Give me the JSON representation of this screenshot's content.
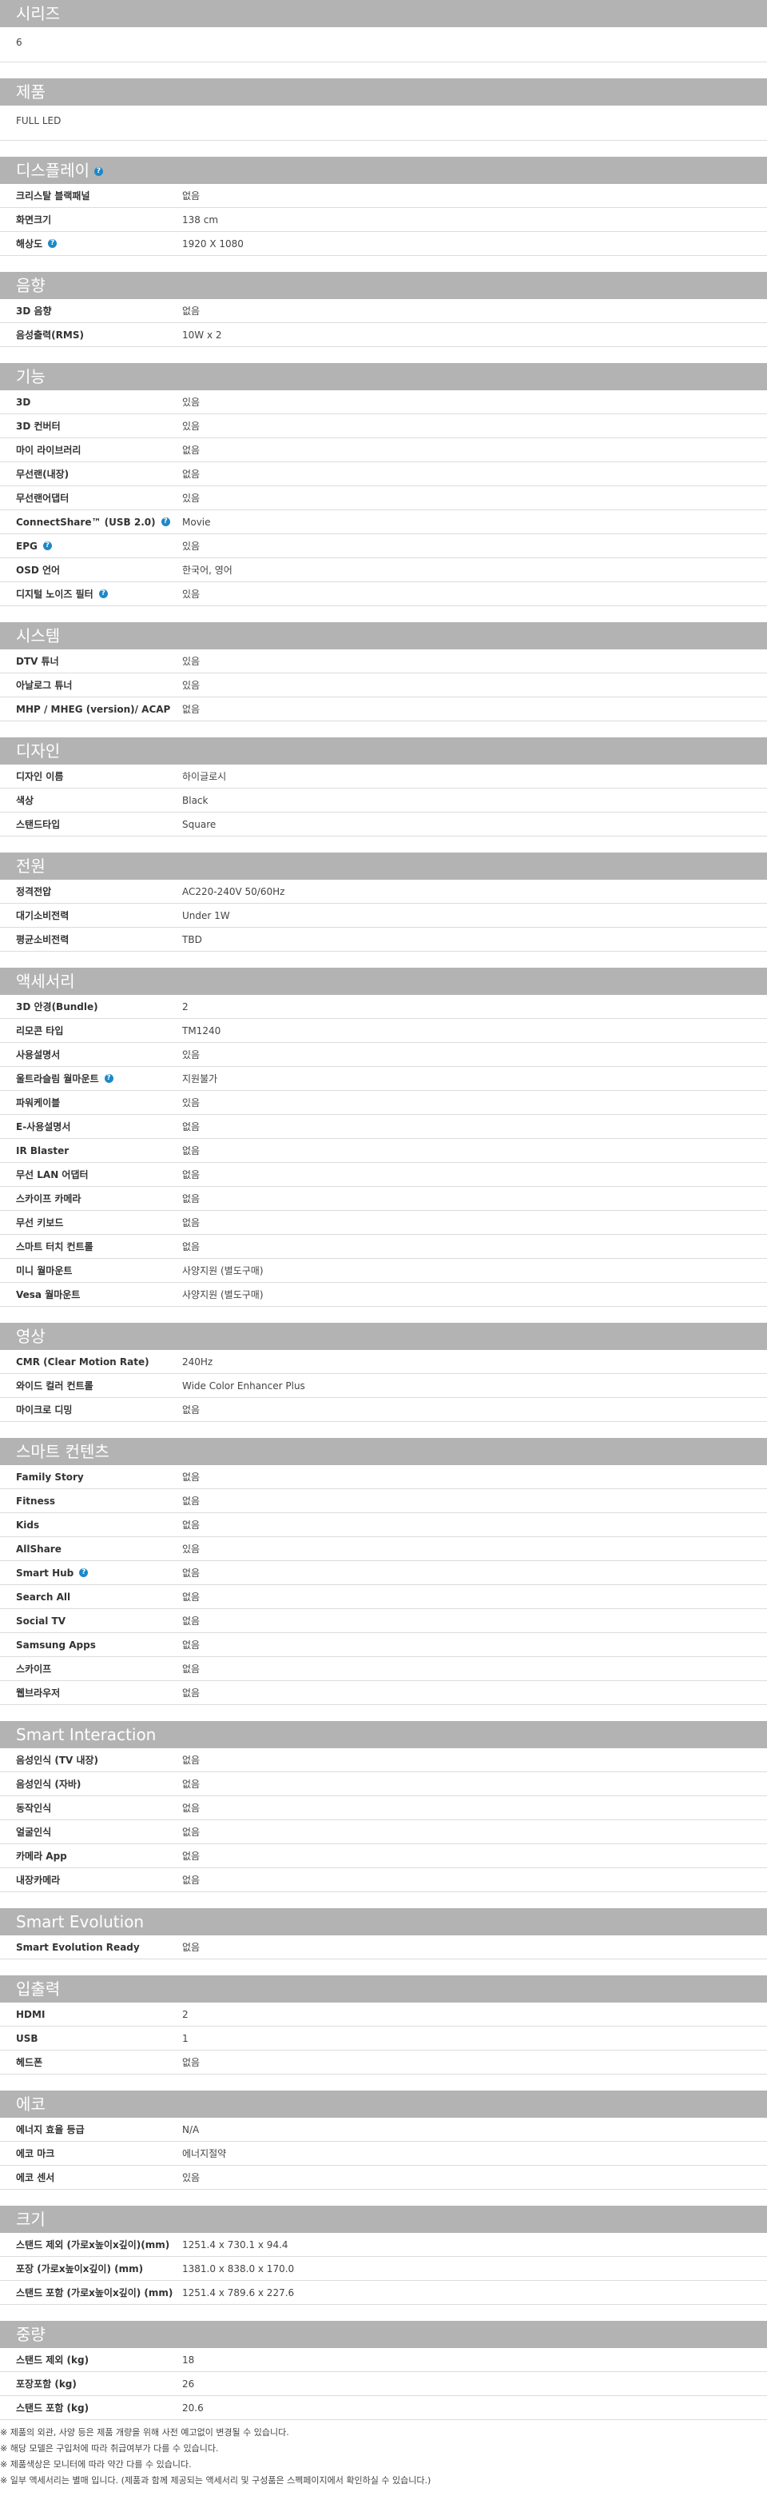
{
  "sections": [
    {
      "title": "시리즈",
      "value": "6"
    },
    {
      "title": "제품",
      "value": "FULL LED"
    },
    {
      "title": "디스플레이",
      "help": true,
      "rows": [
        {
          "label": "크리스탈 블랙패널",
          "value": "없음"
        },
        {
          "label": "화면크기",
          "value": "138 cm"
        },
        {
          "label": "해상도",
          "value": "1920 X 1080",
          "help": true
        }
      ]
    },
    {
      "title": "음향",
      "rows": [
        {
          "label": "3D 음향",
          "value": "없음"
        },
        {
          "label": "음성출력(RMS)",
          "value": "10W x 2"
        }
      ]
    },
    {
      "title": "기능",
      "rows": [
        {
          "label": "3D",
          "value": "있음"
        },
        {
          "label": "3D 컨버터",
          "value": "있음"
        },
        {
          "label": "마이 라이브러리",
          "value": "없음"
        },
        {
          "label": "무선랜(내장)",
          "value": "없음"
        },
        {
          "label": "무선랜어댑터",
          "value": "있음"
        },
        {
          "label": "ConnectShare™ (USB 2.0)",
          "value": "Movie",
          "help": true
        },
        {
          "label": "EPG",
          "value": "있음",
          "help": true
        },
        {
          "label": "OSD 언어",
          "value": "한국어, 영어"
        },
        {
          "label": "디지털 노이즈 필터",
          "value": "있음",
          "help": true
        }
      ]
    },
    {
      "title": "시스템",
      "rows": [
        {
          "label": "DTV 튜너",
          "value": "있음"
        },
        {
          "label": "아날로그 튜너",
          "value": "있음"
        },
        {
          "label": "MHP / MHEG (version)/ ACAP",
          "value": "없음"
        }
      ]
    },
    {
      "title": "디자인",
      "rows": [
        {
          "label": "디자인 이름",
          "value": "하이글로시"
        },
        {
          "label": "색상",
          "value": "Black"
        },
        {
          "label": "스탠드타입",
          "value": "Square"
        }
      ]
    },
    {
      "title": "전원",
      "rows": [
        {
          "label": "정격전압",
          "value": "AC220-240V 50/60Hz"
        },
        {
          "label": "대기소비전력",
          "value": "Under 1W"
        },
        {
          "label": "평균소비전력",
          "value": "TBD"
        }
      ]
    },
    {
      "title": "액세서리",
      "rows": [
        {
          "label": "3D 안경(Bundle)",
          "value": "2"
        },
        {
          "label": "리모콘 타입",
          "value": "TM1240"
        },
        {
          "label": "사용설명서",
          "value": "있음"
        },
        {
          "label": "울트라슬림 월마운트",
          "value": "지원불가",
          "help": true
        },
        {
          "label": "파워케이블",
          "value": "있음"
        },
        {
          "label": "E-사용설명서",
          "value": "없음"
        },
        {
          "label": "IR Blaster",
          "value": "없음"
        },
        {
          "label": "무선 LAN 어댑터",
          "value": "없음"
        },
        {
          "label": "스카이프 카메라",
          "value": "없음"
        },
        {
          "label": "무선 키보드",
          "value": "없음"
        },
        {
          "label": "스마트 터치 컨트롤",
          "value": "없음"
        },
        {
          "label": "미니 월마운트",
          "value": "사양지원 (별도구매)"
        },
        {
          "label": "Vesa 월마운트",
          "value": "사양지원 (별도구매)"
        }
      ]
    },
    {
      "title": "영상",
      "rows": [
        {
          "label": "CMR (Clear Motion Rate)",
          "value": "240Hz"
        },
        {
          "label": "와이드 컬러 컨트롤",
          "value": "Wide Color Enhancer Plus"
        },
        {
          "label": "마이크로 디밍",
          "value": "없음"
        }
      ]
    },
    {
      "title": "스마트 컨텐츠",
      "rows": [
        {
          "label": "Family Story",
          "value": "없음"
        },
        {
          "label": "Fitness",
          "value": "없음"
        },
        {
          "label": "Kids",
          "value": "없음"
        },
        {
          "label": "AllShare",
          "value": "있음"
        },
        {
          "label": "Smart Hub",
          "value": "없음",
          "help": true
        },
        {
          "label": "Search All",
          "value": "없음"
        },
        {
          "label": "Social TV",
          "value": "없음"
        },
        {
          "label": "Samsung Apps",
          "value": "없음"
        },
        {
          "label": "스카이프",
          "value": "없음"
        },
        {
          "label": "웹브라우저",
          "value": "없음"
        }
      ]
    },
    {
      "title": "Smart Interaction",
      "rows": [
        {
          "label": "음성인식 (TV 내장)",
          "value": "없음"
        },
        {
          "label": "음성인식 (자바)",
          "value": "없음"
        },
        {
          "label": "동작인식",
          "value": "없음"
        },
        {
          "label": "얼굴인식",
          "value": "없음"
        },
        {
          "label": "카메라 App",
          "value": "없음"
        },
        {
          "label": "내장카메라",
          "value": "없음"
        }
      ]
    },
    {
      "title": "Smart Evolution",
      "rows": [
        {
          "label": "Smart Evolution Ready",
          "value": "없음"
        }
      ]
    },
    {
      "title": "입출력",
      "rows": [
        {
          "label": "HDMI",
          "value": "2"
        },
        {
          "label": "USB",
          "value": "1"
        },
        {
          "label": "헤드폰",
          "value": "없음"
        }
      ]
    },
    {
      "title": "에코",
      "rows": [
        {
          "label": "에너지 효율 등급",
          "value": "N/A"
        },
        {
          "label": "에코 마크",
          "value": "에너지절약"
        },
        {
          "label": "에코 센서",
          "value": "있음"
        }
      ]
    },
    {
      "title": "크기",
      "rows": [
        {
          "label": "스탠드 제외 (가로x높이x깊이)(mm)",
          "value": "1251.4 x 730.1 x 94.4"
        },
        {
          "label": "포장 (가로x높이x깊이) (mm)",
          "value": "1381.0 x 838.0 x 170.0"
        },
        {
          "label": "스탠드 포함 (가로x높이x깊이) (mm)",
          "value": "1251.4 x 789.6 x 227.6"
        }
      ]
    },
    {
      "title": "중량",
      "rows": [
        {
          "label": "스탠드 제외 (kg)",
          "value": "18"
        },
        {
          "label": "포장포함 (kg)",
          "value": "26"
        },
        {
          "label": "스탠드 포함 (kg)",
          "value": "20.6"
        }
      ]
    }
  ],
  "notes": [
    "※ 제품의 외관, 사양 등은 제품 개량을 위해 사전 예고없이 변경될 수 있습니다.",
    "※ 해당 모델은 구입처에 따라 취급여부가 다를 수 있습니다.",
    "※ 제품색상은 모니터에 따라 약간 다를 수 있습니다.",
    "※ 일부 액세서리는 별매 입니다. (제품과 함께 제공되는 액세서리 및 구성품은 스펙페이지에서 확인하실 수 있습니다.)"
  ]
}
